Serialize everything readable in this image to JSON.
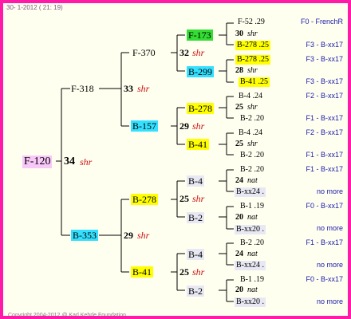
{
  "header": "30-  1-2012 ( 21: 19)",
  "footer": "Copyright 2004-2012 @ Karl Kehrle Foundation.",
  "root": {
    "label": "F-120",
    "num": "34",
    "suffix": "shr"
  },
  "gen1": [
    {
      "label": "F-318",
      "num": "33",
      "suffix": "shr"
    },
    {
      "label": "B-353",
      "num": "29",
      "suffix": "shr"
    }
  ],
  "gen2": [
    {
      "label": "F-370",
      "num": "32",
      "suffix": "shr"
    },
    {
      "label": "B-157",
      "num": "29",
      "suffix": "shr"
    },
    {
      "label": "B-278",
      "num": "25",
      "suffix": "shr"
    },
    {
      "label": "B-41",
      "num": "25",
      "suffix": "shr"
    }
  ],
  "gen3": [
    {
      "label": "F-173",
      "num": "30",
      "suffix": "shr"
    },
    {
      "label": "B-299",
      "num": "28",
      "suffix": "shr"
    },
    {
      "label": "B-278",
      "num": "25",
      "suffix": "shr"
    },
    {
      "label": "B-41",
      "num": "25",
      "suffix": "shr"
    },
    {
      "label": "B-4",
      "num": "24",
      "suffix": "nat"
    },
    {
      "label": "B-2",
      "num": "20",
      "suffix": "nat"
    },
    {
      "label": "B-4",
      "num": "24",
      "suffix": "nat"
    },
    {
      "label": "B-2",
      "num": "20",
      "suffix": "nat"
    }
  ],
  "gen4": [
    {
      "label": "F-52 .29",
      "right": "F0 - FrenchR"
    },
    {
      "label": "B-278 .25",
      "right": "F3 - B-xx17"
    },
    {
      "label": "B-278 .25",
      "right": "F3 - B-xx17"
    },
    {
      "label": "B-41 .25",
      "right": "F3 - B-xx17"
    },
    {
      "label": "B-4 .24",
      "right": "F2 - B-xx17"
    },
    {
      "label": "B-2 .20",
      "right": "F1 - B-xx17"
    },
    {
      "label": "B-4 .24",
      "right": "F2 - B-xx17"
    },
    {
      "label": "B-2 .20",
      "right": "F1 - B-xx17"
    },
    {
      "label": "B-2 .20",
      "right": "F1 - B-xx17"
    },
    {
      "label": "B-xx24 .",
      "right": "no more"
    },
    {
      "label": "B-1 .19",
      "right": "F0 - B-xx17"
    },
    {
      "label": "B-xx20 .",
      "right": "no more"
    },
    {
      "label": "B-2 .20",
      "right": "F1 - B-xx17"
    },
    {
      "label": "B-xx24 .",
      "right": "no more"
    },
    {
      "label": "B-1 .19",
      "right": "F0 - B-xx17"
    },
    {
      "label": "B-xx20 .",
      "right": "no more"
    }
  ]
}
